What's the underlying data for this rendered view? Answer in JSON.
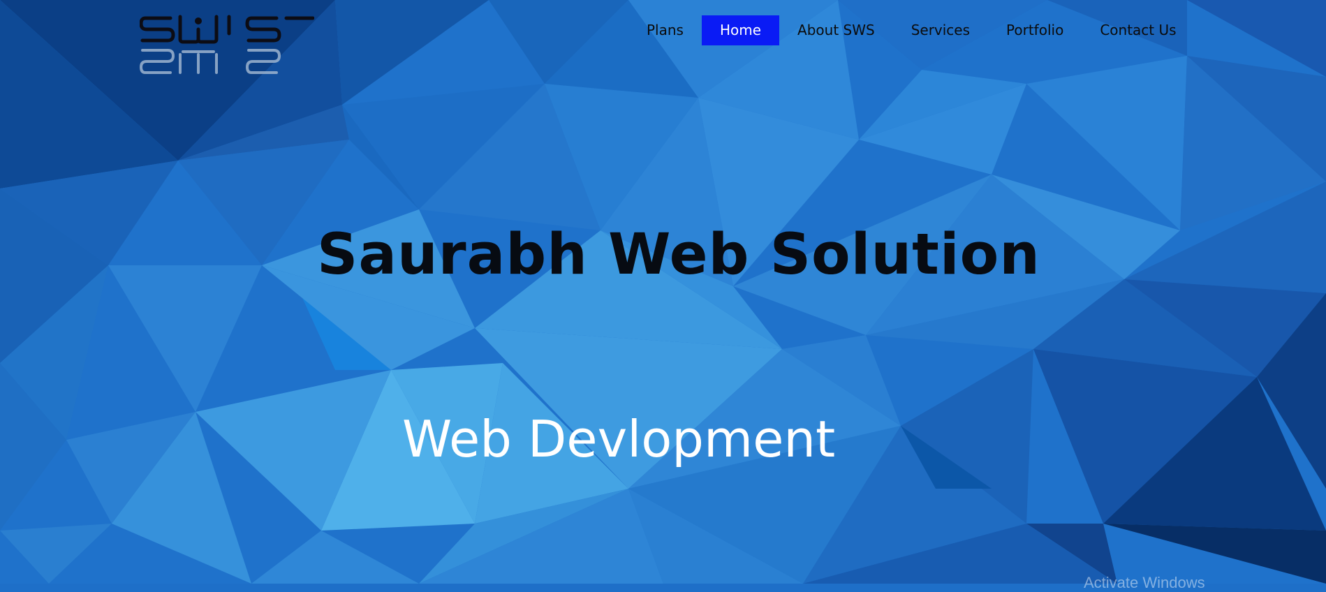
{
  "brand": {
    "logo_text": "SWS",
    "logo_icon": "sws-logo-icon",
    "colors": {
      "logo_fill": "#0c0c14",
      "logo_reflection": "#9db4cf"
    }
  },
  "nav": {
    "items": [
      {
        "label": "Plans"
      },
      {
        "label": "Home"
      },
      {
        "label": "About SWS"
      },
      {
        "label": "Services"
      },
      {
        "label": "Portfolio"
      },
      {
        "label": "Contact Us"
      }
    ],
    "active_label": "Home",
    "active_color": "#0a1bf5"
  },
  "hero": {
    "title": "Saurabh Web Solution",
    "subtitle": "Web Devlopment"
  },
  "os_watermark": {
    "text": "Activate Windows"
  },
  "theme": {
    "background": "blue low-poly triangles",
    "bg_light": "#48a8e4",
    "bg_mid": "#2377d0",
    "bg_dark": "#0a3a80"
  }
}
